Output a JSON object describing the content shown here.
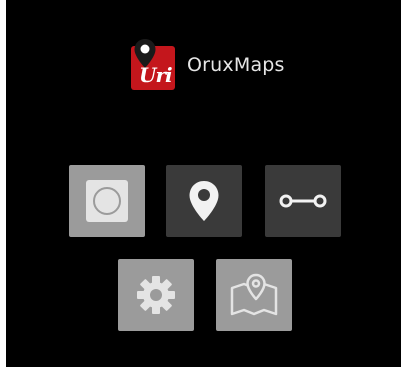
{
  "app": {
    "title": "OruxMaps",
    "logo_text": "Uri"
  },
  "buttons": [
    {
      "id": "record",
      "icon": "record-icon",
      "enabled": false
    },
    {
      "id": "waypoint",
      "icon": "map-pin-icon",
      "enabled": true
    },
    {
      "id": "route",
      "icon": "route-icon",
      "enabled": true
    },
    {
      "id": "settings",
      "icon": "gear-icon",
      "enabled": false
    },
    {
      "id": "maps",
      "icon": "map-icon",
      "enabled": false
    }
  ],
  "colors": {
    "background": "#000000",
    "tile_disabled": "#9b9b9b",
    "tile_enabled": "#3a3a3a",
    "brand_red": "#c4161c",
    "text": "#e6e6e6"
  }
}
